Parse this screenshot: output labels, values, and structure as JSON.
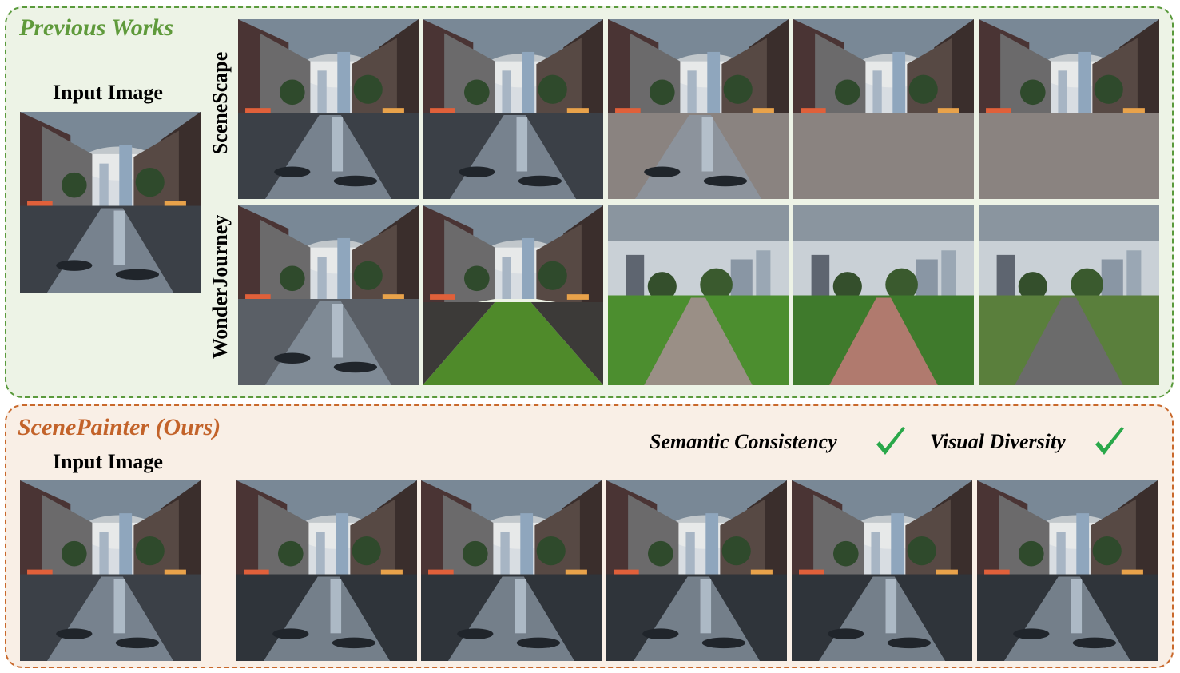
{
  "previous": {
    "title": "Previous Works",
    "input_label": "Input Image",
    "rows": [
      {
        "label": "SceneScape",
        "frames": [
          "street-view-1",
          "street-view-2",
          "street-view-3",
          "street-view-4",
          "street-view-5"
        ]
      },
      {
        "label": "WonderJourney",
        "frames": [
          "street-canal",
          "plaza-lawn",
          "park-lawn",
          "park-path",
          "park-road"
        ]
      }
    ]
  },
  "ours": {
    "title": "ScenePainter (Ours)",
    "input_label": "Input Image",
    "badges": [
      {
        "label": "Semantic Consistency",
        "icon": "check-icon"
      },
      {
        "label": "Visual Diversity",
        "icon": "check-icon"
      }
    ],
    "frames": [
      "wet-street-1",
      "wet-street-2",
      "wet-street-3",
      "wet-street-4",
      "wet-street-5"
    ]
  },
  "colors": {
    "previous_accent": "#5a9a3c",
    "ours_accent": "#c9692c",
    "check": "#2aa84a"
  }
}
